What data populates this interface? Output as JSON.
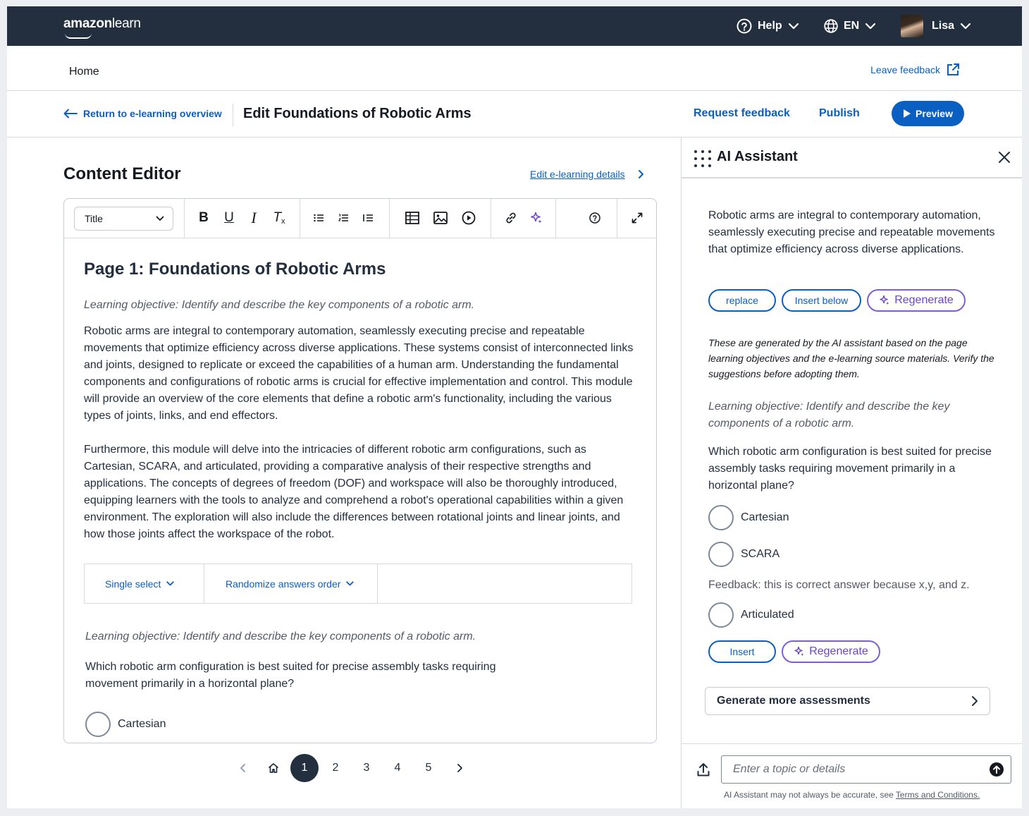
{
  "topbar": {
    "logo_brand": "amazon",
    "logo_product": "learn",
    "help_label": "Help",
    "lang_label": "EN",
    "user_name": "Lisa"
  },
  "breadcrumb": {
    "home": "Home",
    "leave_feedback": "Leave feedback"
  },
  "header": {
    "return_label": "Return to e-learning overview",
    "title": "Edit Foundations of Robotic Arms",
    "request_feedback": "Request feedback",
    "publish": "Publish",
    "preview": "Preview"
  },
  "editor": {
    "heading": "Content Editor",
    "edit_details": "Edit e-learning details",
    "style_select": "Title",
    "page_title": "Page 1: Foundations of Robotic Arms",
    "learning_objective": "Learning objective: Identify and describe the key components of a robotic arm.",
    "paragraph1": "Robotic arms are integral to contemporary automation, seamlessly executing precise and repeatable movements that optimize efficiency across diverse applications. These systems consist of interconnected links and joints, designed to replicate or exceed the capabilities of a human arm. Understanding the fundamental components and configurations of robotic arms is crucial for effective implementation and control. This module will provide an overview of the core elements that define a robotic arm's functionality, including the various types of joints, links, and end effectors.",
    "paragraph2": "Furthermore, this module will delve into the intricacies of different robotic arm configurations, such as Cartesian, SCARA, and articulated, providing a comparative analysis of their respective strengths and applications. The concepts of degrees of freedom (DOF) and workspace will also be thoroughly introduced, equipping learners with the tools to analyze and comprehend a robot's operational capabilities within a given environment. The exploration will also include the differences between rotational joints and linear joints, and how those joints affect the workspace of the robot.",
    "question_type": "Single select",
    "answer_order": "Randomize answers order",
    "question_objective": "Learning objective: Identify and describe the key components of a robotic arm.",
    "question": "Which robotic arm configuration is best suited for precise assembly tasks requiring movement primarily in a horizontal plane?",
    "options": [
      "Cartesian"
    ]
  },
  "pagination": {
    "pages": [
      "1",
      "2",
      "3",
      "4",
      "5"
    ],
    "current": "1"
  },
  "ai_assistant": {
    "title": "AI Assistant",
    "suggestion": "Robotic arms are integral to contemporary automation, seamlessly executing precise and repeatable movements that optimize efficiency across diverse applications.",
    "replace": "replace",
    "insert_below": "Insert below",
    "regenerate": "Regenerate",
    "note": "These are generated by the AI assistant based on the page learning objectives and the e-learning source materials. Verify the suggestions before adopting them.",
    "learning_objective": "Learning objective: Identify and describe the key components of a robotic arm.",
    "question": "Which robotic arm configuration is best suited for precise assembly tasks requiring movement primarily in a horizontal plane?",
    "options": [
      "Cartesian",
      "SCARA",
      "Articulated"
    ],
    "feedback": "Feedback: this is correct answer because x,y, and z.",
    "insert": "Insert",
    "regenerate2": "Regenerate",
    "generate_more": "Generate more assessments",
    "prompt_placeholder": "Enter a topic or details",
    "disclaimer": "AI Assistant may not always be accurate, see",
    "terms": "Terms and Conditions."
  },
  "colors": {
    "topbar": "#232f3e",
    "link": "#0a5fc2",
    "ai_accent": "#7d5fd3"
  }
}
